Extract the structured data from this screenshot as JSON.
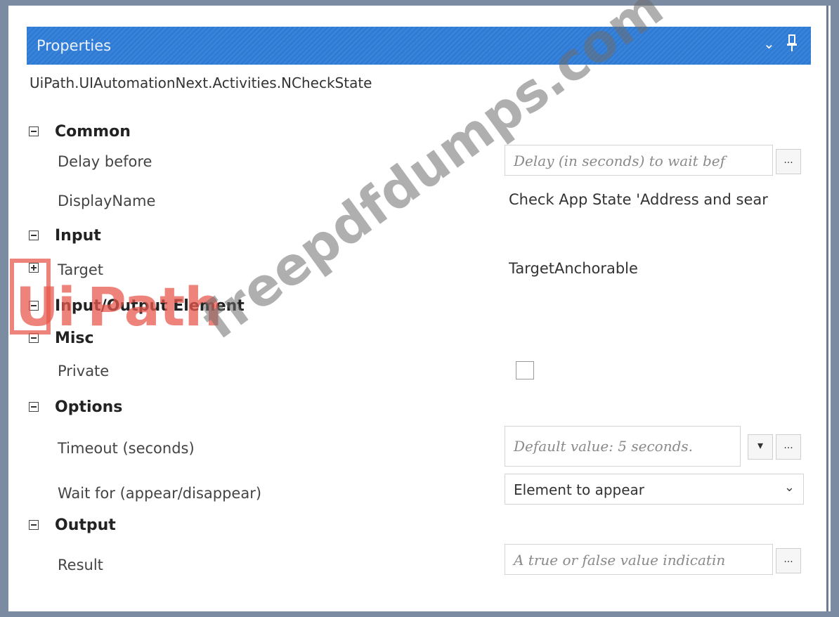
{
  "header": {
    "title": "Properties",
    "chevron_icon": "chevron-down-icon",
    "pin_icon": "pin-icon"
  },
  "activity_type": "UiPath.UIAutomationNext.Activities.NCheckState",
  "categories": {
    "common": {
      "label": "Common",
      "delay_before": {
        "label": "Delay before",
        "placeholder": "Delay (in seconds) to wait bef",
        "button": "..."
      },
      "display_name": {
        "label": "DisplayName",
        "value": "Check App State 'Address and sear"
      }
    },
    "input": {
      "label": "Input",
      "target": {
        "label": "Target",
        "value": "TargetAnchorable"
      }
    },
    "input_output_element": {
      "label": "Input/Output Element"
    },
    "misc": {
      "label": "Misc",
      "private": {
        "label": "Private",
        "checked": false
      }
    },
    "options": {
      "label": "Options",
      "timeout": {
        "label": "Timeout (seconds)",
        "placeholder": "Default value: 5 seconds.",
        "dropdown": "▾",
        "button": "..."
      },
      "wait_for": {
        "label": "Wait for (appear/disappear)",
        "value": "Element to appear"
      }
    },
    "output": {
      "label": "Output",
      "result": {
        "label": "Result",
        "placeholder": "A true or false value indicatin",
        "button": "..."
      }
    }
  },
  "watermark": {
    "logo_ui": "Ui",
    "logo_path": "Path",
    "text": "freepdfdumps.com"
  }
}
